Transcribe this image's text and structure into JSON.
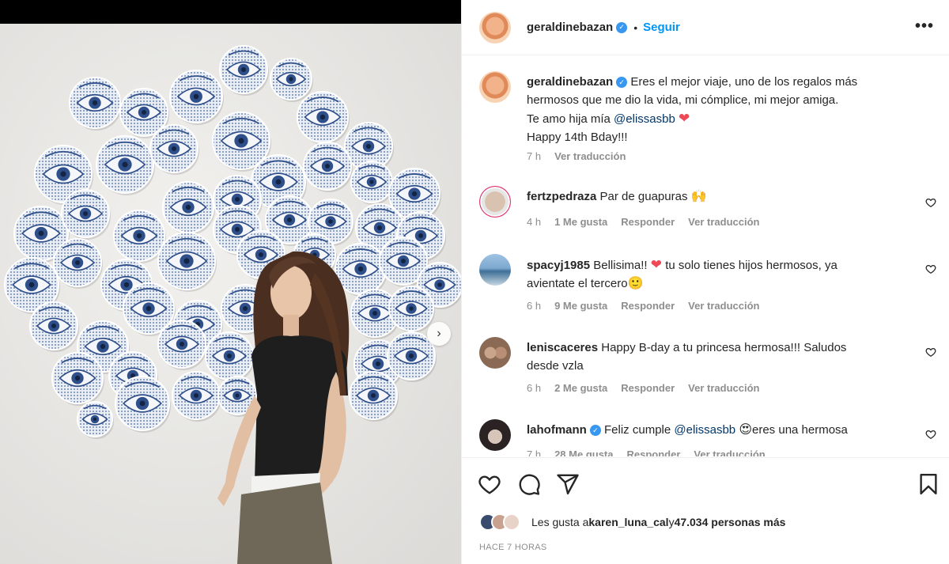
{
  "post": {
    "author": "geraldinebazan",
    "follow_label": "Seguir",
    "header_separator": "•",
    "more_label": "•••"
  },
  "caption": {
    "username": "geraldinebazan",
    "line1": "Eres el mejor viaje, uno de los regalos más",
    "line2": "hermosos que me dio la vida, mi cómplice, mi mejor amiga.",
    "line3_prefix": "Te amo hija mía ",
    "line3_mention": "@elissasbb",
    "line4": "Happy 14th Bday!!!",
    "time": "7 h",
    "translate": "Ver traducción"
  },
  "comments": [
    {
      "username": "fertzpedraza",
      "text": "Par de guapuras",
      "emoji": "🙌",
      "time": "4 h",
      "likes": "1 Me gusta",
      "reply": "Responder",
      "translate": "Ver traducción"
    },
    {
      "username": "spacyj1985",
      "text_a": "Bellisima!! ",
      "text_b": " tu solo tienes hijos hermosos, ya",
      "text_c": "avientate el tercero",
      "emoji": "🙂",
      "time": "6 h",
      "likes": "9 Me gusta",
      "reply": "Responder",
      "translate": "Ver traducción"
    },
    {
      "username": "leniscaceres",
      "text_a": "Happy B-day a tu princesa hermosa!!! Saludos",
      "text_b": "desde vzla",
      "time": "6 h",
      "likes": "2 Me gusta",
      "reply": "Responder",
      "translate": "Ver traducción"
    },
    {
      "username": "lahofmann",
      "text_prefix": "Feliz cumple ",
      "mention": "@elissasbb",
      "emoji": "😍",
      "text_suffix": "eres una hermosa",
      "time": "7 h",
      "likes": "28 Me gusta",
      "reply": "Responder",
      "translate": "Ver traducción"
    }
  ],
  "likes": {
    "prefix": "Les gusta a ",
    "user": "karen_luna_cal",
    "middle": " y ",
    "count": "47.034 personas más"
  },
  "posted": "HACE 7 HORAS",
  "icons": {
    "like": "heart-icon",
    "comment": "comment-icon",
    "share": "paper-plane-icon",
    "save": "bookmark-icon",
    "next": "chevron-right-icon",
    "more": "more-options-icon",
    "verified": "verified-badge-icon"
  },
  "colors": {
    "accent": "#0095f6",
    "verified": "#3897f0",
    "mention": "#00376b",
    "heart": "#ed4956",
    "muted": "#8e8e8e",
    "plate_blue": "#2f4f8a"
  }
}
